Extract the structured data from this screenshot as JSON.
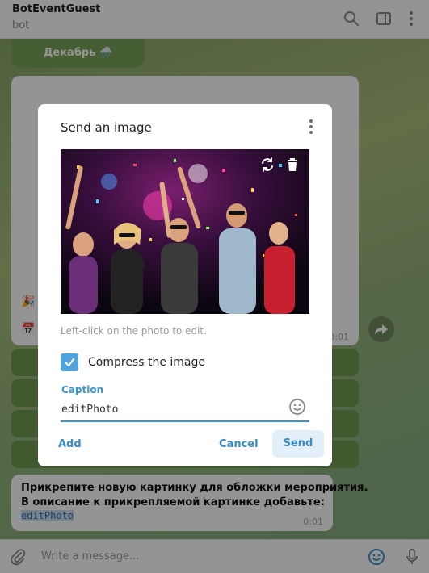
{
  "header": {
    "title": "BotEventGuest",
    "status": "bot",
    "icons": [
      "search-icon",
      "sidebar-toggle-icon",
      "more-icon"
    ]
  },
  "chat": {
    "date_pill": "Декабрь 🌧️",
    "bubble_time": "0:01",
    "bottom_message": {
      "line1": "Прикрепите новую картинку для обложки мероприятия.",
      "line2": "В описание к прикрепляемой картинке  добавьте:",
      "code": "editPhoto",
      "time": "0:01"
    }
  },
  "modal": {
    "title": "Send an image",
    "edit_hint": "Left-click on the photo to edit.",
    "compress_label": "Compress the image",
    "compress_checked": true,
    "caption_label": "Caption",
    "caption_value": "editPhoto",
    "add_label": "Add",
    "cancel_label": "Cancel",
    "send_label": "Send"
  },
  "footer": {
    "placeholder": "Write a message...",
    "icons": [
      "attach-icon",
      "emoji-icon",
      "microphone-icon"
    ]
  },
  "colors": {
    "accent": "#3a95d1",
    "checkbox": "#4fa4de",
    "chat_bg": "#93b27a",
    "keyboard_button": "#6f9a52"
  }
}
